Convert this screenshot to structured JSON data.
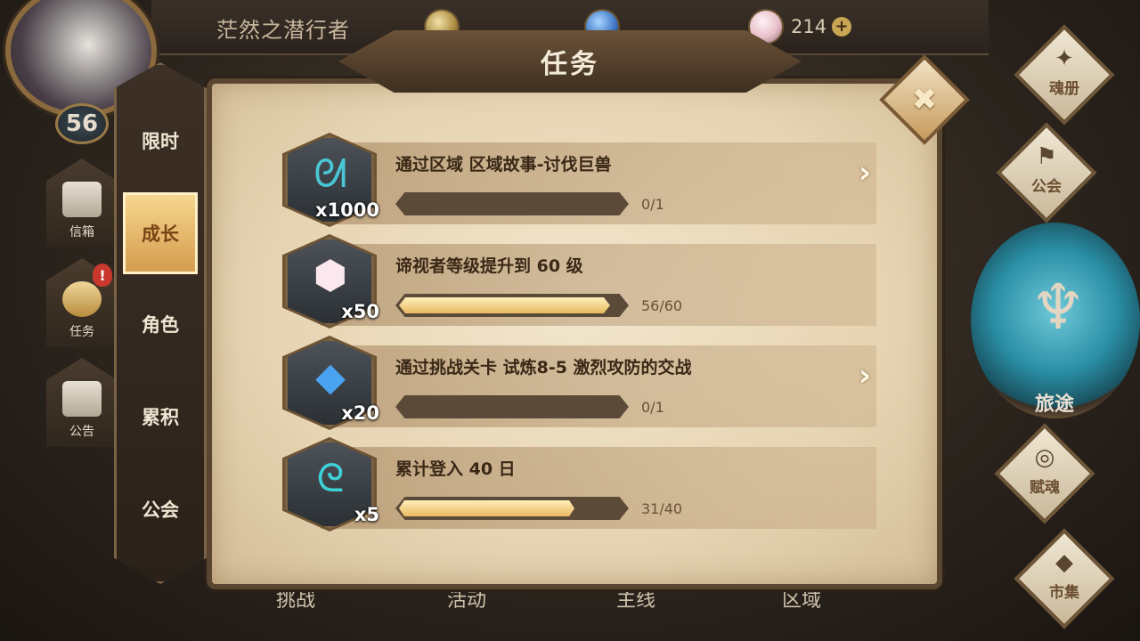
{
  "player": {
    "name": "茫然之潜行者",
    "level": "56"
  },
  "currencies": {
    "crystal": "214",
    "plus_symbol": "+"
  },
  "left_nav": [
    {
      "label": "信箱",
      "icon": "envelope-icon"
    },
    {
      "label": "任务",
      "icon": "quest-shield-icon",
      "alert": "!"
    },
    {
      "label": "公告",
      "icon": "notice-board-icon"
    }
  ],
  "dialog": {
    "title": "任务",
    "close_symbol": "✖",
    "tabs": [
      {
        "label": "限时",
        "active": false
      },
      {
        "label": "成长",
        "active": true
      },
      {
        "label": "角色",
        "active": false
      },
      {
        "label": "累积",
        "active": false
      },
      {
        "label": "公会",
        "active": false
      }
    ],
    "quests": [
      {
        "title": "通过区域 区域故事-讨伐巨兽",
        "reward_qty": "x1000",
        "reward_icon": "teal-rune-icon",
        "progress_text": "0/1",
        "progress": 0.0,
        "go_arrow": true
      },
      {
        "title": "谛视者等级提升到 60 级",
        "reward_qty": "x50",
        "reward_icon": "crystal-gem-icon",
        "progress_text": "56/60",
        "progress": 0.9333,
        "go_arrow": false
      },
      {
        "title": "通过挑战关卡 试炼8-5 激烈攻防的交战",
        "reward_qty": "x20",
        "reward_icon": "blue-crystal-icon",
        "progress_text": "0/1",
        "progress": 0.0,
        "go_arrow": true
      },
      {
        "title": "累计登入 40 日",
        "reward_qty": "x5",
        "reward_icon": "teal-swirl-icon",
        "progress_text": "31/40",
        "progress": 0.775,
        "go_arrow": false
      }
    ]
  },
  "bottom_tabs": [
    "挑战",
    "活动",
    "主线",
    "区域"
  ],
  "right_nav": [
    {
      "label": "魂册",
      "icon": "soulbook-icon"
    },
    {
      "label": "公会",
      "icon": "guild-icon"
    },
    {
      "label": "旅途",
      "icon": "journey-emblem-icon"
    },
    {
      "label": "赋魂",
      "icon": "talent-icon"
    },
    {
      "label": "市集",
      "icon": "market-icon"
    }
  ],
  "colors": {
    "parchment": "#f2e6cc",
    "frame": "#5a4530",
    "progress_fill": "#e9b961",
    "active_tab": "#f7d68e"
  }
}
